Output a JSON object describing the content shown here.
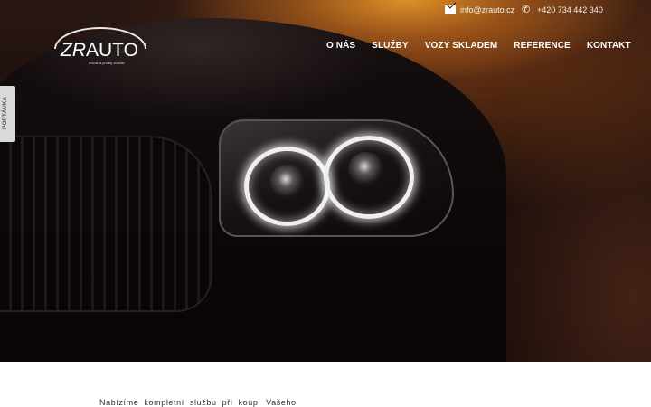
{
  "brand": {
    "logo_text_italic": "ZR",
    "logo_text_main": "AUTO",
    "tagline": "dovoz a prodej vozidel"
  },
  "contact": {
    "email": "info@zrauto.cz",
    "phone": "+420 734 442 340",
    "email_icon": "envelope-icon",
    "phone_icon": "phone-icon"
  },
  "nav": {
    "items": [
      "O NÁS",
      "SLUŽBY",
      "VOZY SKLADEM",
      "REFERENCE",
      "KONTAKT"
    ]
  },
  "side_tab": {
    "label": "POPTÁVKA"
  },
  "intro": {
    "text": "Nabízíme kompletní službu při koupi Vašeho"
  },
  "colors": {
    "hero_dark": "#160c0a",
    "hero_glow": "#e69628",
    "side_tab_bg": "#d9d9d9"
  }
}
